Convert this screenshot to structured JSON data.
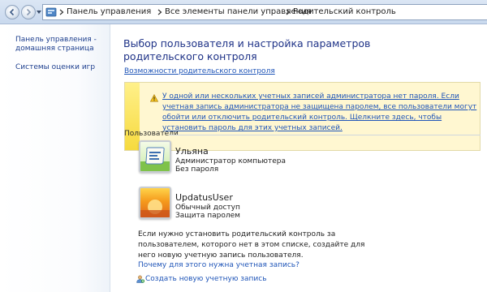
{
  "address_bar": {
    "icon": "control-panel-icon",
    "breadcrumbs": [
      "Панель управления",
      "Все элементы панели управления",
      "Родительский контроль"
    ]
  },
  "sidebar": {
    "home_link": "Панель управления - домашняя страница",
    "rating_link": "Системы оценки игр"
  },
  "main": {
    "title": "Выбор пользователя и настройка параметров родительского контроля",
    "features_link": "Возможности родительского контроля",
    "warning": {
      "icon": "warning-icon",
      "text": "У одной или нескольких учетных записей администратора нет пароля. Если учетная запись администратора не защищена паролем, все пользователи могут обойти или отключить родительский контроль. Щелкните здесь, чтобы установить пароль для этих учетных записей."
    },
    "users_heading": "Пользователи",
    "users": [
      {
        "name": "Ульяна",
        "type": "Администратор компьютера",
        "password": "Без пароля",
        "avatar": "scroll-avatar"
      },
      {
        "name": "UpdatusUser",
        "type": "Обычный доступ",
        "password": "Защита паролем",
        "avatar": "sunset-avatar"
      }
    ],
    "info_text": "Если нужно установить родительский контроль за пользователем, которого нет в этом списке, создайте для него новую учетную запись пользователя.",
    "why_link": "Почему для этого нужна учетная запись?",
    "create_link": "Создать новую учетную запись"
  },
  "colors": {
    "link": "#1f55b8",
    "title": "#1e3287",
    "warning_bg": "#fff7d1",
    "warning_stripe": "#f6da3e"
  }
}
